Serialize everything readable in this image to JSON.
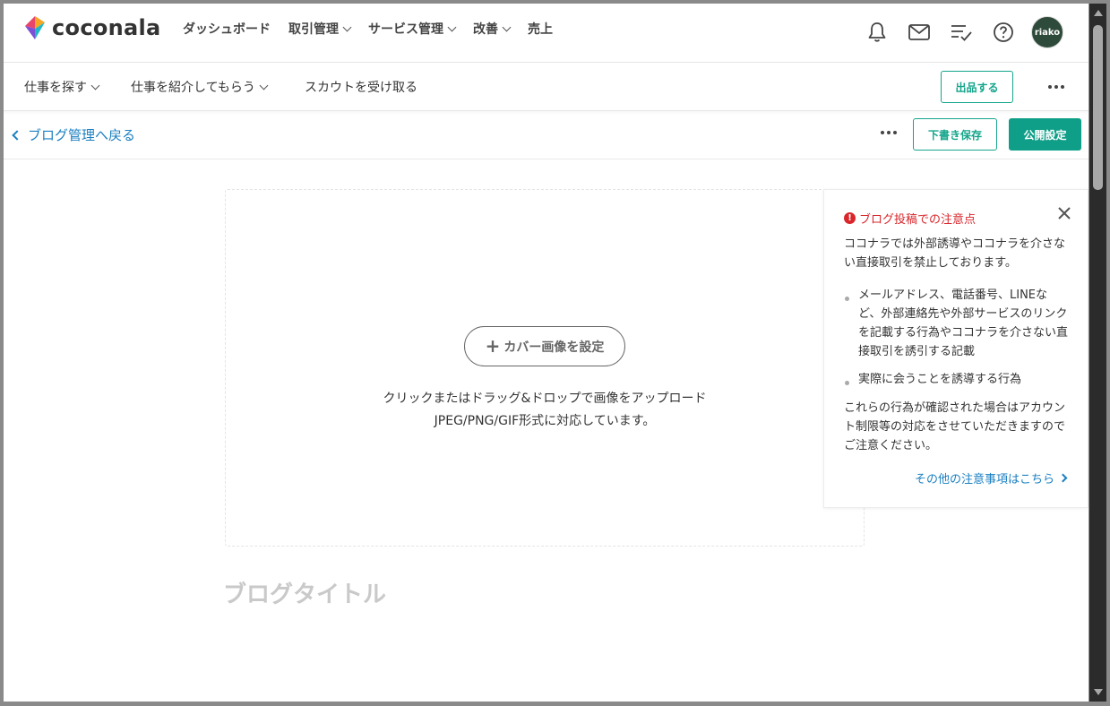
{
  "brand": {
    "name": "coconala"
  },
  "main_nav": [
    {
      "label": "ダッシュボード",
      "has_dropdown": false
    },
    {
      "label": "取引管理",
      "has_dropdown": true
    },
    {
      "label": "サービス管理",
      "has_dropdown": true
    },
    {
      "label": "改善",
      "has_dropdown": true
    },
    {
      "label": "売上",
      "has_dropdown": false
    }
  ],
  "header_icons": [
    "bell-icon",
    "mail-icon",
    "checklist-icon",
    "help-icon"
  ],
  "user": {
    "avatar_text": "riako"
  },
  "sub_nav": {
    "items": [
      {
        "label": "仕事を探す",
        "has_dropdown": true
      },
      {
        "label": "仕事を紹介してもらう",
        "has_dropdown": true
      },
      {
        "label": "スカウトを受け取る",
        "has_dropdown": false
      }
    ],
    "listing_button": "出品する"
  },
  "editor_toolbar": {
    "back_link": "ブログ管理へ戻る",
    "save_draft": "下書き保存",
    "publish_settings": "公開設定"
  },
  "cover": {
    "button": "カバー画像を設定",
    "hint_line1": "クリックまたはドラッグ&ドロップで画像をアップロード",
    "hint_line2": "JPEG/PNG/GIF形式に対応しています。"
  },
  "blog_title_placeholder": "ブログタイトル",
  "notice": {
    "title": "ブログ投稿での注意点",
    "intro": "ココナラでは外部誘導やココナラを介さない直接取引を禁止しております。",
    "items": [
      "メールアドレス、電話番号、LINEなど、外部連絡先や外部サービスのリンクを記載する行為やココナラを介さない直接取引を誘引する記載",
      "実際に会うことを誘導する行為"
    ],
    "outro": "これらの行為が確認された場合はアカウント制限等の対応をさせていただきますのでご注意ください。",
    "link": "その他の注意事項はこちら"
  },
  "colors": {
    "accent": "#0f9f88",
    "link": "#1a7fc1",
    "warning": "#d8262b"
  }
}
